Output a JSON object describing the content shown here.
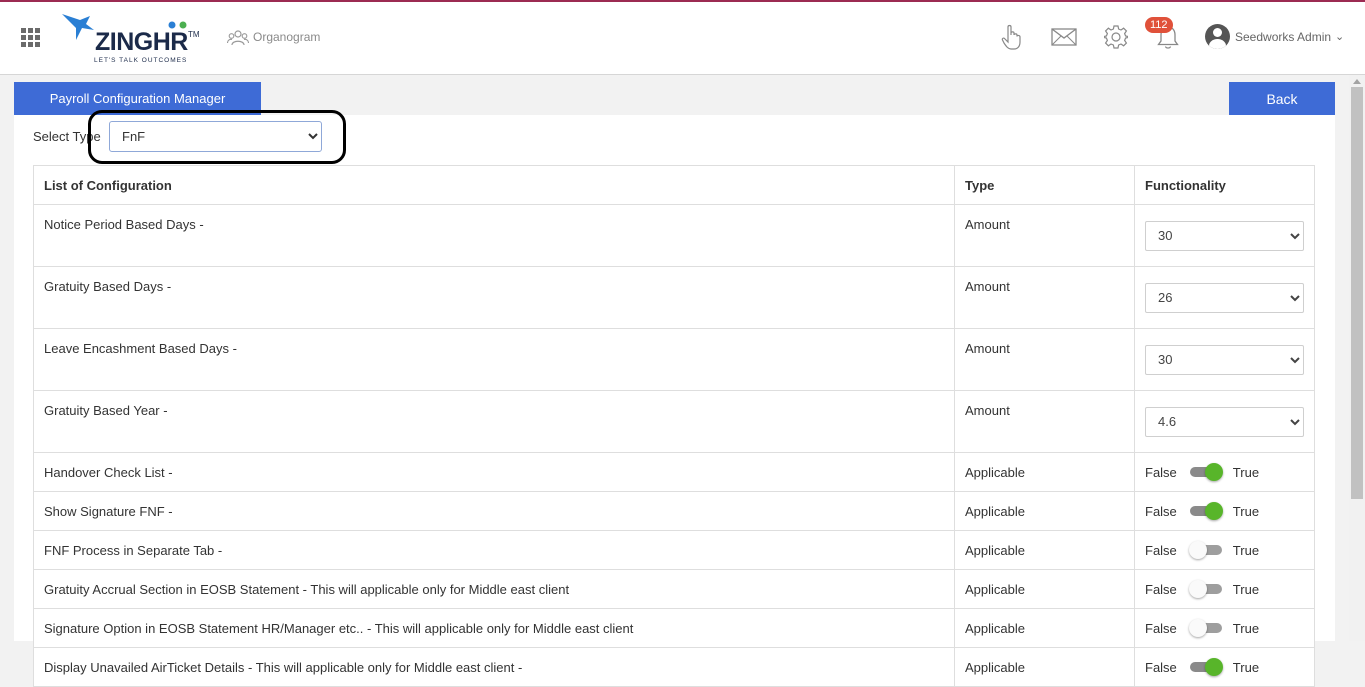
{
  "header": {
    "logo_text": "ZINGHR",
    "logo_tm": "TM",
    "logo_tagline": "LET'S TALK OUTCOMES",
    "organogram_label": "Organogram",
    "notification_count": "112",
    "user_name": "Seedworks Admin",
    "user_caret": "⌄"
  },
  "page": {
    "title": "Payroll Configuration Manager",
    "back_label": "Back",
    "select_type_label": "Select Type",
    "select_type_value": "FnF"
  },
  "table": {
    "headers": [
      "List of Configuration",
      "Type",
      "Functionality"
    ],
    "amount_rows": [
      {
        "label": "Notice Period Based Days -",
        "type": "Amount",
        "value": "30"
      },
      {
        "label": "Gratuity Based Days -",
        "type": "Amount",
        "value": "26"
      },
      {
        "label": "Leave Encashment Based Days -",
        "type": "Amount",
        "value": "30"
      },
      {
        "label": "Gratuity Based Year -",
        "type": "Amount",
        "value": "4.6"
      }
    ],
    "toggle_rows": [
      {
        "label": "Handover Check List -",
        "type": "Applicable",
        "false_label": "False",
        "true_label": "True",
        "on": true
      },
      {
        "label": "Show Signature FNF -",
        "type": "Applicable",
        "false_label": "False",
        "true_label": "True",
        "on": true
      },
      {
        "label": "FNF Process in Separate Tab -",
        "type": "Applicable",
        "false_label": "False",
        "true_label": "True",
        "on": false
      },
      {
        "label": "Gratuity Accrual Section in EOSB Statement - This will applicable only for Middle east client",
        "type": "Applicable",
        "false_label": "False",
        "true_label": "True",
        "on": false
      },
      {
        "label": "Signature Option in EOSB Statement HR/Manager etc.. - This will applicable only for Middle east client",
        "type": "Applicable",
        "false_label": "False",
        "true_label": "True",
        "on": false
      },
      {
        "label": "Display Unavailed AirTicket Details - This will applicable only for Middle east client -",
        "type": "Applicable",
        "false_label": "False",
        "true_label": "True",
        "on": true
      }
    ]
  },
  "colors": {
    "primary": "#3e6bd6",
    "toggle_on": "#58b52a",
    "badge": "#e0513a",
    "brand_line": "#9c2b52"
  }
}
